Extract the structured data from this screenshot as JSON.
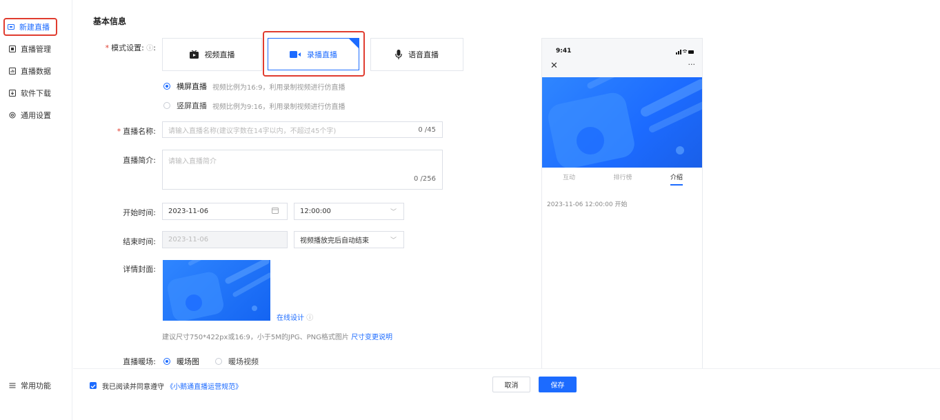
{
  "sidebar": {
    "items": [
      {
        "label": "新建直播",
        "icon": "live-create-icon"
      },
      {
        "label": "直播管理",
        "icon": "manage-icon"
      },
      {
        "label": "直播数据",
        "icon": "data-icon"
      },
      {
        "label": "软件下载",
        "icon": "download-icon"
      },
      {
        "label": "通用设置",
        "icon": "gear-icon"
      }
    ],
    "bottom_label": "常用功能"
  },
  "section_title": "基本信息",
  "mode": {
    "label": "模式设置",
    "options": [
      "视频直播",
      "录播直播",
      "语音直播"
    ],
    "selected": "录播直播"
  },
  "orientation": [
    {
      "title": "横屏直播",
      "hint": "视频比例为16:9，利用录制视频进行仿直播",
      "checked": true
    },
    {
      "title": "竖屏直播",
      "hint": "视频比例为9:16，利用录制视频进行仿直播",
      "checked": false
    }
  ],
  "name_field": {
    "label": "直播名称:",
    "placeholder": "请输入直播名称(建议字数在14字以内，不超过45个字)",
    "count": "0 /45"
  },
  "intro_field": {
    "label": "直播简介:",
    "placeholder": "请输入直播简介",
    "count": "0 /256"
  },
  "start_time": {
    "label": "开始时间:",
    "date": "2023-11-06",
    "time": "12:00:00"
  },
  "end_time": {
    "label": "结束时间:",
    "date": "2023-11-06",
    "mode": "视频播放完后自动结束"
  },
  "cover": {
    "label": "详情封面:",
    "design_link": "在线设计",
    "hint": "建议尺寸750*422px或16:9，小于5M的JPG、PNG格式图片",
    "hint_link": "尺寸变更说明"
  },
  "warmup": {
    "label": "直播暖场:",
    "options": [
      "暖场图",
      "暖场视频"
    ],
    "selected": "暖场图"
  },
  "footer": {
    "agree_text": "我已阅读并同意遵守",
    "agree_link": "《小鹅通直播运营规范》",
    "cancel": "取消",
    "save": "保存"
  },
  "phone": {
    "time": "9:41",
    "tabs": [
      "互动",
      "排行榜",
      "介绍"
    ],
    "active_tab": "介绍",
    "intro_text": "2023-11-06 12:00:00 开始"
  },
  "colors": {
    "accent": "#1c6bff",
    "highlight": "#e03b2e"
  }
}
